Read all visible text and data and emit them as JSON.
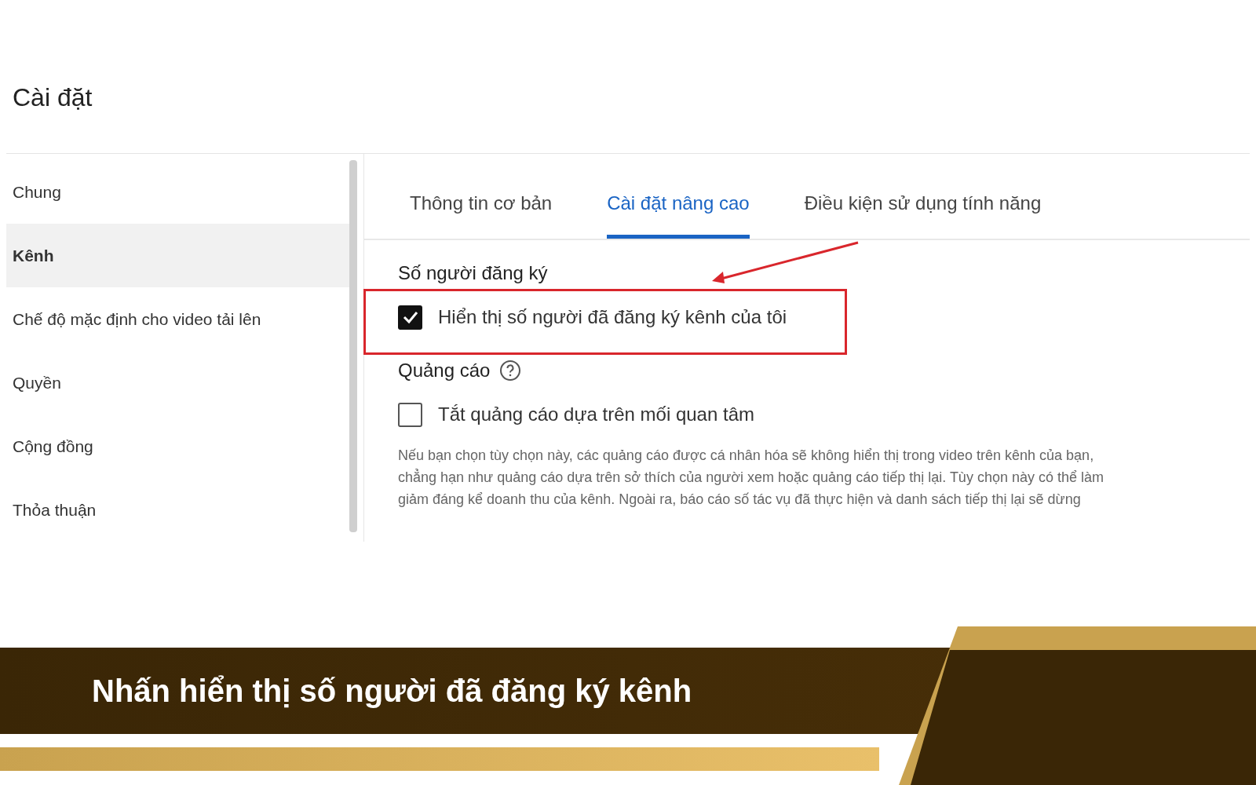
{
  "page_title": "Cài đặt",
  "sidebar": {
    "items": [
      {
        "label": "Chung",
        "selected": false
      },
      {
        "label": "Kênh",
        "selected": true
      },
      {
        "label": "Chế độ mặc định cho video tải lên",
        "selected": false
      },
      {
        "label": "Quyền",
        "selected": false
      },
      {
        "label": "Cộng đồng",
        "selected": false
      },
      {
        "label": "Thỏa thuận",
        "selected": false
      }
    ]
  },
  "tabs": [
    {
      "label": "Thông tin cơ bản",
      "selected": false
    },
    {
      "label": "Cài đặt nâng cao",
      "selected": true
    },
    {
      "label": "Điều kiện sử dụng tính năng",
      "selected": false
    }
  ],
  "sections": [
    {
      "heading": "Số người đăng ký",
      "help": false,
      "checkbox": {
        "label": "Hiển thị số người đã đăng ký kênh của tôi",
        "checked": true,
        "highlighted": true
      }
    },
    {
      "heading": "Quảng cáo",
      "help": true,
      "checkbox": {
        "label": "Tắt quảng cáo dựa trên mối quan tâm",
        "checked": false,
        "highlighted": false
      },
      "description": [
        "Nếu bạn chọn tùy chọn này, các quảng cáo được cá nhân hóa sẽ không hiển thị trong video trên kênh của bạn,",
        "chẳng hạn như quảng cáo dựa trên sở thích của người xem hoặc quảng cáo tiếp thị lại. Tùy chọn này có thể làm",
        "giảm đáng kể doanh thu của kênh. Ngoài ra, báo cáo số tác vụ đã thực hiện và danh sách tiếp thị lại sẽ dừng"
      ]
    }
  ],
  "caption": "Nhấn hiển thị số người đã đăng ký kênh"
}
